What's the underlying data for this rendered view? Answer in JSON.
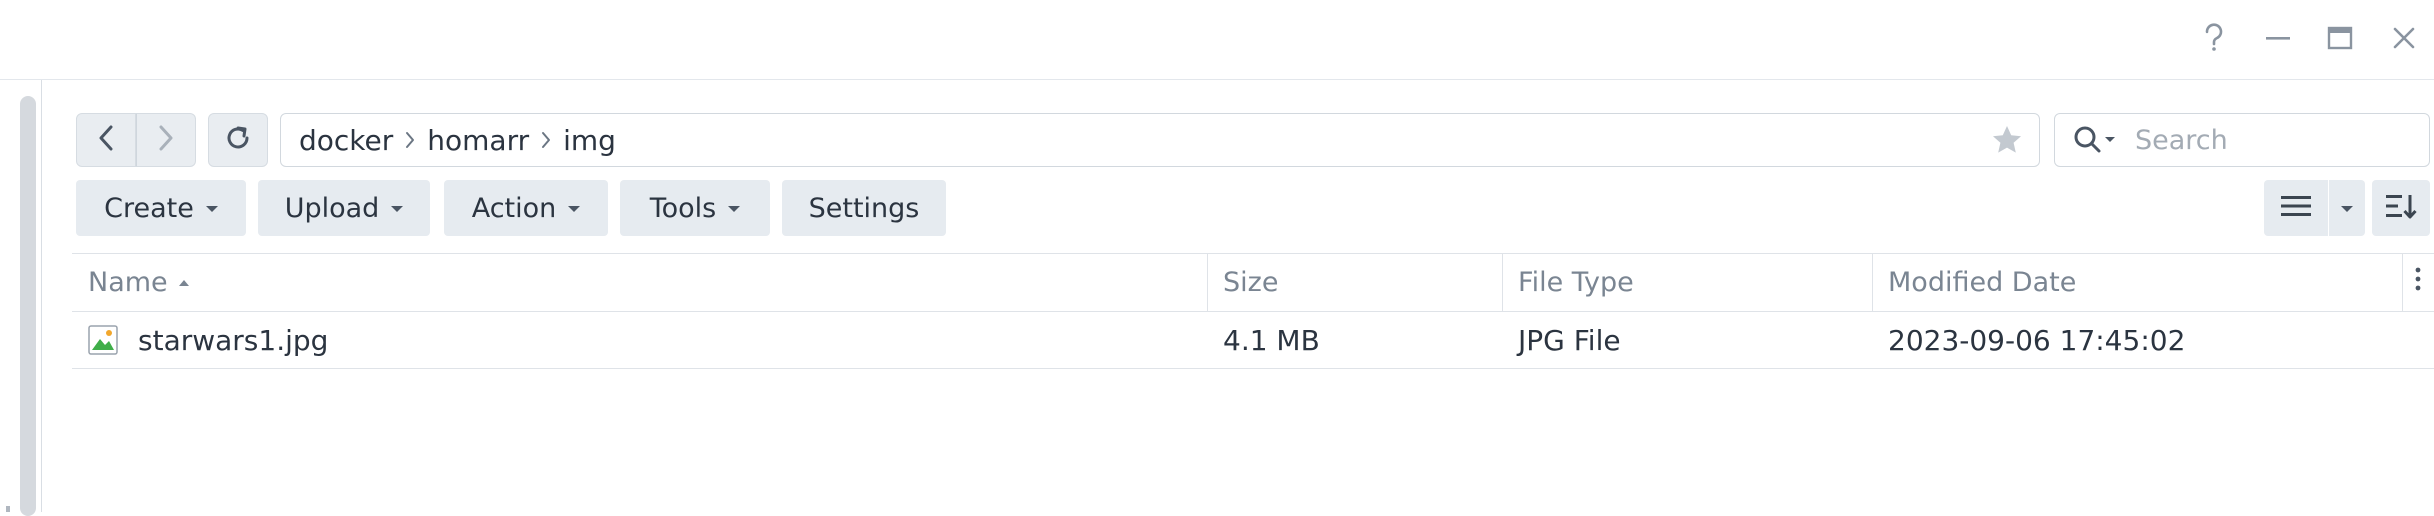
{
  "window": {
    "help_icon": "question-mark-icon",
    "minimize_icon": "minimize-icon",
    "maximize_icon": "maximize-icon",
    "close_icon": "close-icon"
  },
  "toolbar": {
    "path": [
      "docker",
      "homarr",
      "img"
    ],
    "search_placeholder": "Search",
    "buttons": {
      "create": "Create",
      "upload": "Upload",
      "action": "Action",
      "tools": "Tools",
      "settings": "Settings"
    }
  },
  "table": {
    "columns": {
      "name": "Name",
      "size": "Size",
      "type": "File Type",
      "modified": "Modified Date"
    },
    "sort": {
      "column": "name",
      "direction": "ascending"
    },
    "rows": [
      {
        "name": "starwars1.jpg",
        "size": "4.1 MB",
        "type": "JPG File",
        "modified": "2023-09-06 17:45:02",
        "icon": "image-file-icon"
      }
    ]
  },
  "colors": {
    "accent_green": "#3fae49",
    "button_bg": "#e6ebf0",
    "text": "#2b3440",
    "muted_text": "#7a8592"
  }
}
